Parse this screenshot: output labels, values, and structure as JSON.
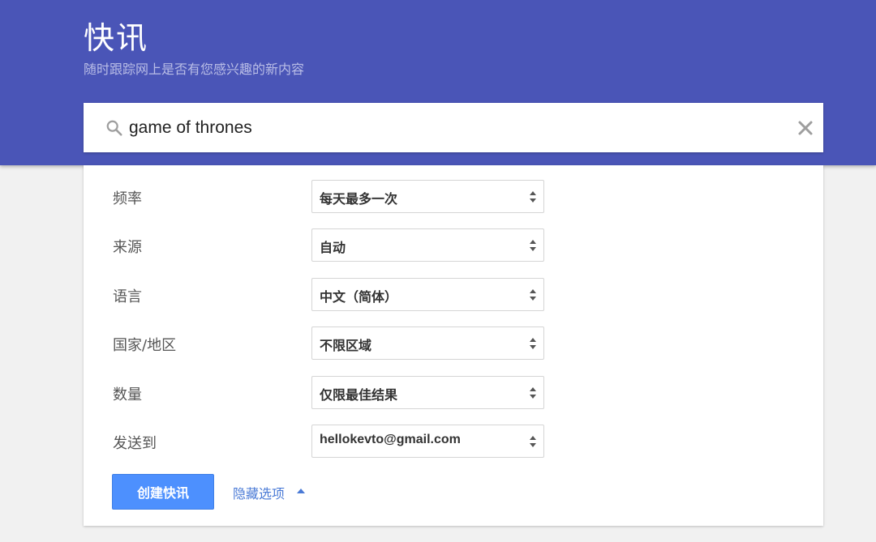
{
  "header": {
    "title": "快讯",
    "subtitle": "随时跟踪网上是否有您感兴趣的新内容"
  },
  "search": {
    "value": "game of thrones",
    "search_icon": "search-icon",
    "clear_icon": "close-icon"
  },
  "options": [
    {
      "label": "频率",
      "value": "每天最多一次"
    },
    {
      "label": "来源",
      "value": "自动"
    },
    {
      "label": "语言",
      "value": "中文（简体）"
    },
    {
      "label": "国家/地区",
      "value": "不限区域"
    },
    {
      "label": "数量",
      "value": "仅限最佳结果"
    },
    {
      "label": "发送到",
      "value": "hellokevto@gmail.com"
    }
  ],
  "actions": {
    "create_label": "创建快讯",
    "hide_options_label": "隐藏选项"
  },
  "colors": {
    "header_bg": "#4a55b7",
    "primary_button": "#4d90fe",
    "link": "#4a7ad6"
  }
}
